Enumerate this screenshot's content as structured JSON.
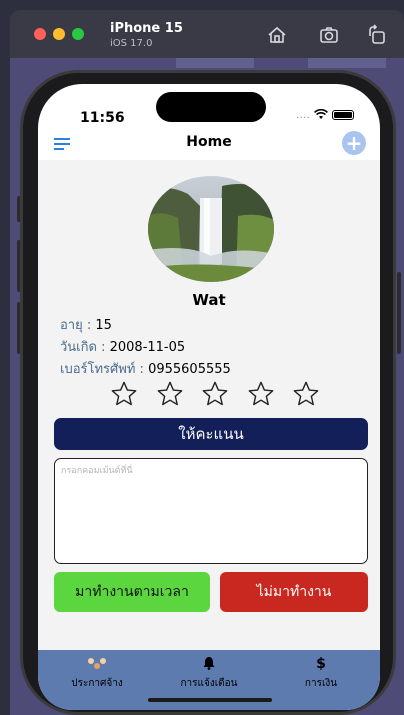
{
  "simulator": {
    "device": "iPhone 15",
    "os": "iOS 17.0"
  },
  "status_bar": {
    "time": "11:56",
    "signal": "....",
    "wifi_icon": "wifi-icon",
    "battery_icon": "battery-icon"
  },
  "header": {
    "title": "Home",
    "menu_icon": "menu-icon",
    "add_icon": "plus-icon",
    "add_symbol": "+"
  },
  "profile": {
    "name": "Wat",
    "age_label": "อายุ :",
    "age_value": "15",
    "dob_label": "วันเกิด :",
    "dob_value": "2008-11-05",
    "phone_label": "เบอร์โทรศัพท์ :",
    "phone_value": "0955605555"
  },
  "rating": {
    "max_stars": 5,
    "selected": 0
  },
  "rate_button": "ให้คะแนน",
  "comment": {
    "placeholder": "กรอกคอมเม้นต์ที่นี่",
    "value": ""
  },
  "attendance": {
    "present_label": "มาทำงานตามเวลา",
    "absent_label": "ไม่มาทำงาน"
  },
  "tabs": [
    {
      "label": "ประกาศจ้าง",
      "icon": "dots-icon"
    },
    {
      "label": "การแจ้งเตือน",
      "icon": "bell-icon"
    },
    {
      "label": "การเงิน",
      "icon": "dollar-icon",
      "symbol": "$"
    }
  ],
  "colors": {
    "rate_button": "#121f58",
    "present_button": "#5cd63f",
    "absent_button": "#c8281f",
    "tabbar": "#5e7bb0",
    "accent": "#2f7fe0"
  }
}
